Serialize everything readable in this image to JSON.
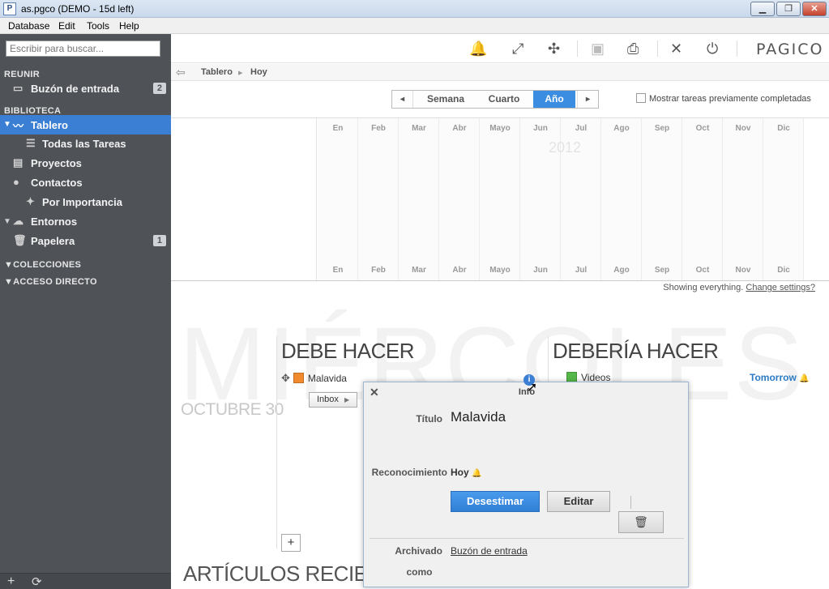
{
  "window": {
    "title": "as.pgco (DEMO - 15d left)",
    "app_icon": "P",
    "min_label": "▁",
    "max_label": "❐",
    "close_label": "✕"
  },
  "menu": [
    "Database",
    "Edit",
    "Tools",
    "Help"
  ],
  "sidebar": {
    "search_placeholder": "Escribir para buscar...",
    "sections": {
      "reunir": "REUNIR",
      "biblioteca": "BIBLIOTECA",
      "colecciones": "▼COLECCIONES",
      "acceso": "▼ACCESO DIRECTO"
    },
    "items": {
      "buzon": {
        "label": "Buzón de entrada",
        "badge": "2",
        "icon": "inbox-icon"
      },
      "tablero": {
        "label": "Tablero",
        "icon": "dashboard-icon"
      },
      "todas": {
        "label": "Todas las Tareas",
        "icon": "list-icon"
      },
      "proyectos": {
        "label": "Proyectos",
        "icon": "projects-icon"
      },
      "contactos": {
        "label": "Contactos",
        "icon": "person-icon"
      },
      "importancia": {
        "label": "Por Importancia",
        "icon": "person-star-icon"
      },
      "entornos": {
        "label": "Entornos",
        "icon": "cloud-icon"
      },
      "papelera": {
        "label": "Papelera",
        "badge": "1",
        "icon": "trash-icon"
      }
    },
    "bottom": {
      "add": "+",
      "sync": "⟳"
    }
  },
  "toolbar": {
    "icons": [
      "bell-icon",
      "expand-icon",
      "collapse-icon",
      "archive-icon",
      "print-icon",
      "tools-icon",
      "power-icon"
    ],
    "brand": "PAGICO"
  },
  "breadcrumb": {
    "root": "Tablero",
    "separator": "▸",
    "current": "Hoy"
  },
  "range": {
    "prev": "◂",
    "next": "▸",
    "options": [
      "Semana",
      "Cuarto",
      "Año"
    ],
    "selected": "Año",
    "show_completed_label": "Mostrar tareas previamente completadas",
    "show_completed_checked": false
  },
  "calendar": {
    "months": [
      "En",
      "Feb",
      "Mar",
      "Abr",
      "Mayo",
      "Jun",
      "Jul",
      "Ago",
      "Sep",
      "Oct",
      "Nov",
      "Dic"
    ],
    "year": "2012"
  },
  "showing": {
    "text": "Showing everything.",
    "link": "Change settings?"
  },
  "day": {
    "weekday": "MIÉRCOLES",
    "date": "OCTUBRE 30",
    "debe_hacer": "DEBE HACER",
    "deberia_hacer": "DEBERÍA HACER",
    "articulos": "ARTÍCULOS RECIENTES"
  },
  "tasks": {
    "must": {
      "name": "Malavida",
      "color": "#f08a2c",
      "project": "Inbox"
    },
    "should": {
      "name": "Videos",
      "color": "#55b84a",
      "due": "Tomorrow"
    }
  },
  "popup": {
    "title": "Info",
    "close": "✕",
    "titulo_label": "Título",
    "titulo_value": "Malavida",
    "reconocimiento_label": "Reconocimiento",
    "reconocimiento_value": "Hoy",
    "dismiss": "Desestimar",
    "edit": "Editar",
    "archivado_label_1": "Archivado",
    "archivado_label_2": "como",
    "archivado_value": "Buzón de entrada"
  },
  "colors": {
    "accent": "#3a7fd4",
    "sidebar_bg": "#4f5358",
    "link_blue": "#2a7ac4"
  }
}
